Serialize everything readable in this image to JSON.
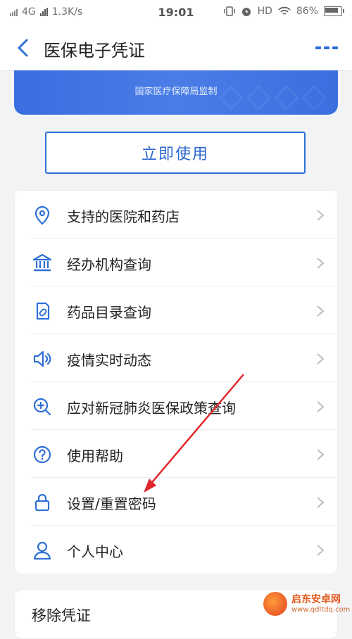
{
  "status_bar": {
    "network": "4G",
    "speed": "1.3K/s",
    "time": "19:01",
    "hd": "HD",
    "battery": "86%"
  },
  "header": {
    "title": "医保电子凭证"
  },
  "card": {
    "supervision_text": "国家医疗保障局监制",
    "use_button": "立即使用"
  },
  "menu": {
    "items": [
      {
        "label": "支持的医院和药店",
        "icon": "location-pin-icon"
      },
      {
        "label": "经办机构查询",
        "icon": "bank-building-icon"
      },
      {
        "label": "药品目录查询",
        "icon": "medicine-catalog-icon"
      },
      {
        "label": "疫情实时动态",
        "icon": "speaker-icon"
      },
      {
        "label": "应对新冠肺炎医保政策查询",
        "icon": "zoom-plus-icon"
      },
      {
        "label": "使用帮助",
        "icon": "question-circle-icon"
      },
      {
        "label": "设置/重置密码",
        "icon": "lock-icon"
      },
      {
        "label": "个人中心",
        "icon": "user-icon"
      }
    ]
  },
  "remove": {
    "label": "移除凭证"
  },
  "watermark": {
    "main": "启东安卓网",
    "sub": "www.qdltdq.com"
  },
  "colors": {
    "accent": "#2f6fd6",
    "card_blue": "#3f73e2",
    "arrow_red": "#e0262b"
  }
}
